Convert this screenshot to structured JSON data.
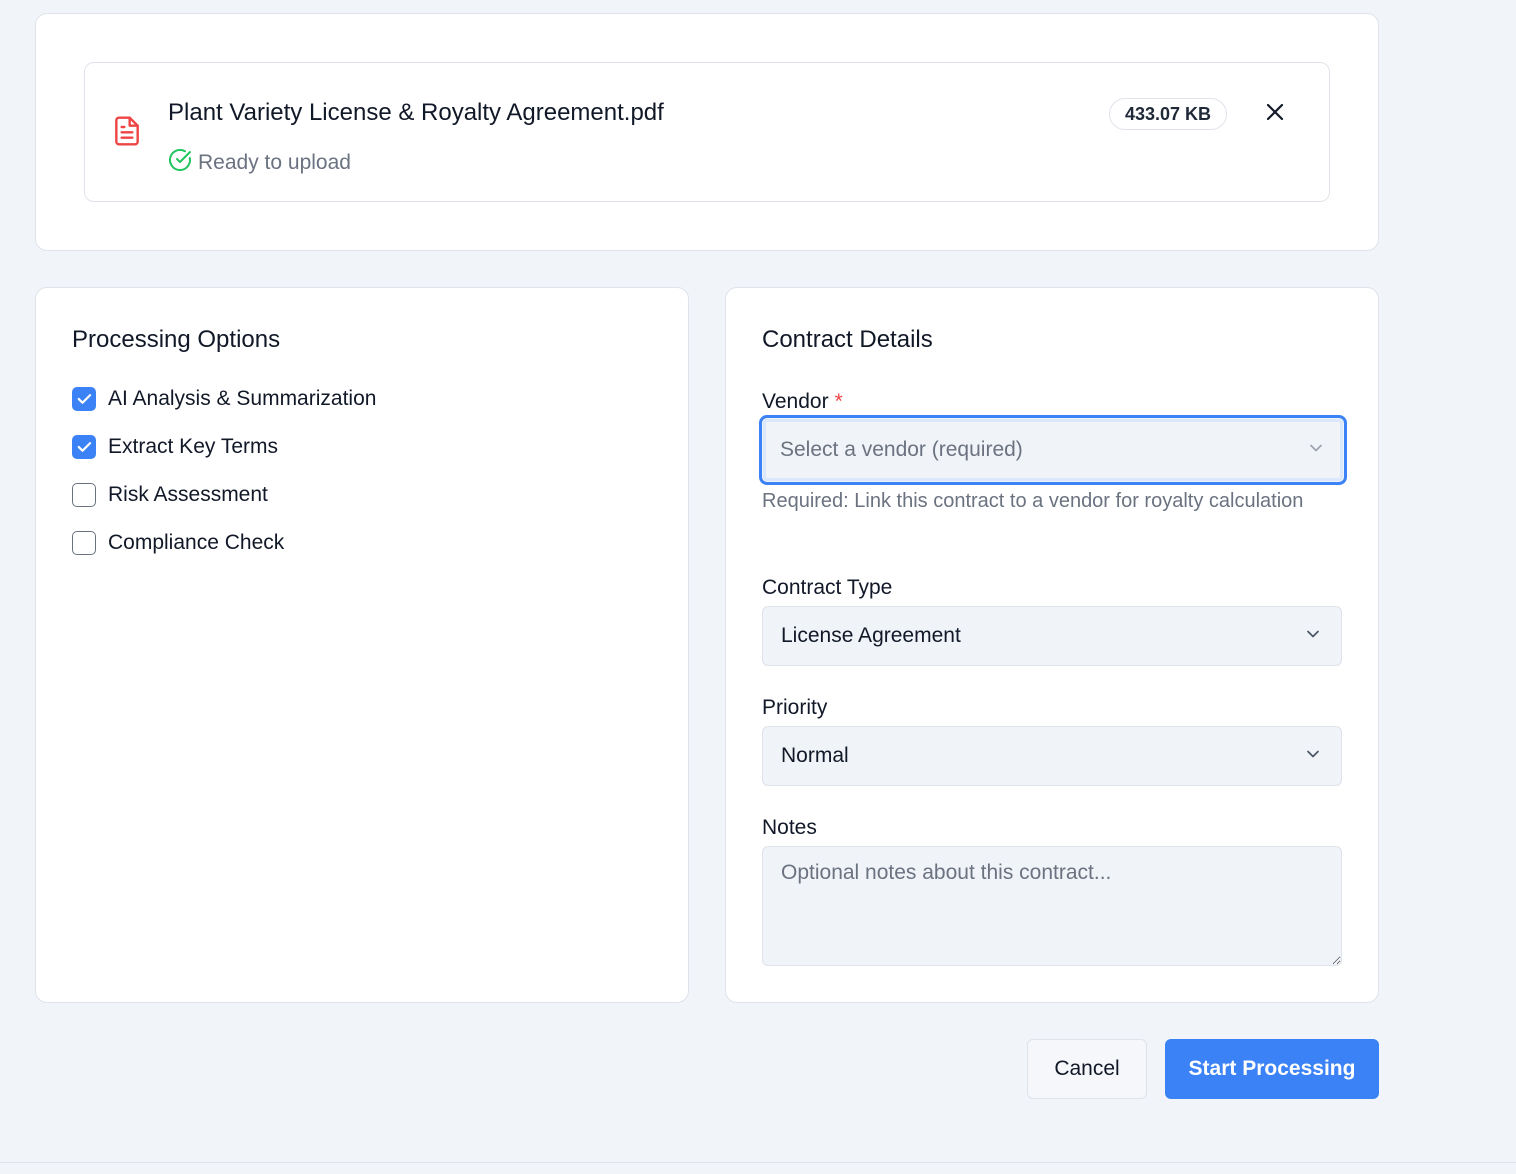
{
  "file": {
    "name": "Plant Variety License & Royalty Agreement.pdf",
    "status": "Ready to upload",
    "size": "433.07 KB",
    "icon": "pdf-document-icon",
    "icon_color": "#ef4444",
    "status_color": "#22c55e"
  },
  "processing_options": {
    "title": "Processing Options",
    "options": [
      {
        "label": "AI Analysis & Summarization",
        "checked": true
      },
      {
        "label": "Extract Key Terms",
        "checked": true
      },
      {
        "label": "Risk Assessment",
        "checked": false
      },
      {
        "label": "Compliance Check",
        "checked": false
      }
    ]
  },
  "contract_details": {
    "title": "Contract Details",
    "vendor": {
      "label": "Vendor",
      "required_mark": "*",
      "placeholder": "Select a vendor (required)",
      "help": "Required: Link this contract to a vendor for royalty calculation"
    },
    "contract_type": {
      "label": "Contract Type",
      "value": "License Agreement"
    },
    "priority": {
      "label": "Priority",
      "value": "Normal"
    },
    "notes": {
      "label": "Notes",
      "placeholder": "Optional notes about this contract..."
    }
  },
  "actions": {
    "cancel": "Cancel",
    "start": "Start Processing"
  },
  "colors": {
    "accent": "#3b82f6",
    "background": "#f1f4f9",
    "required": "#ef4444"
  }
}
